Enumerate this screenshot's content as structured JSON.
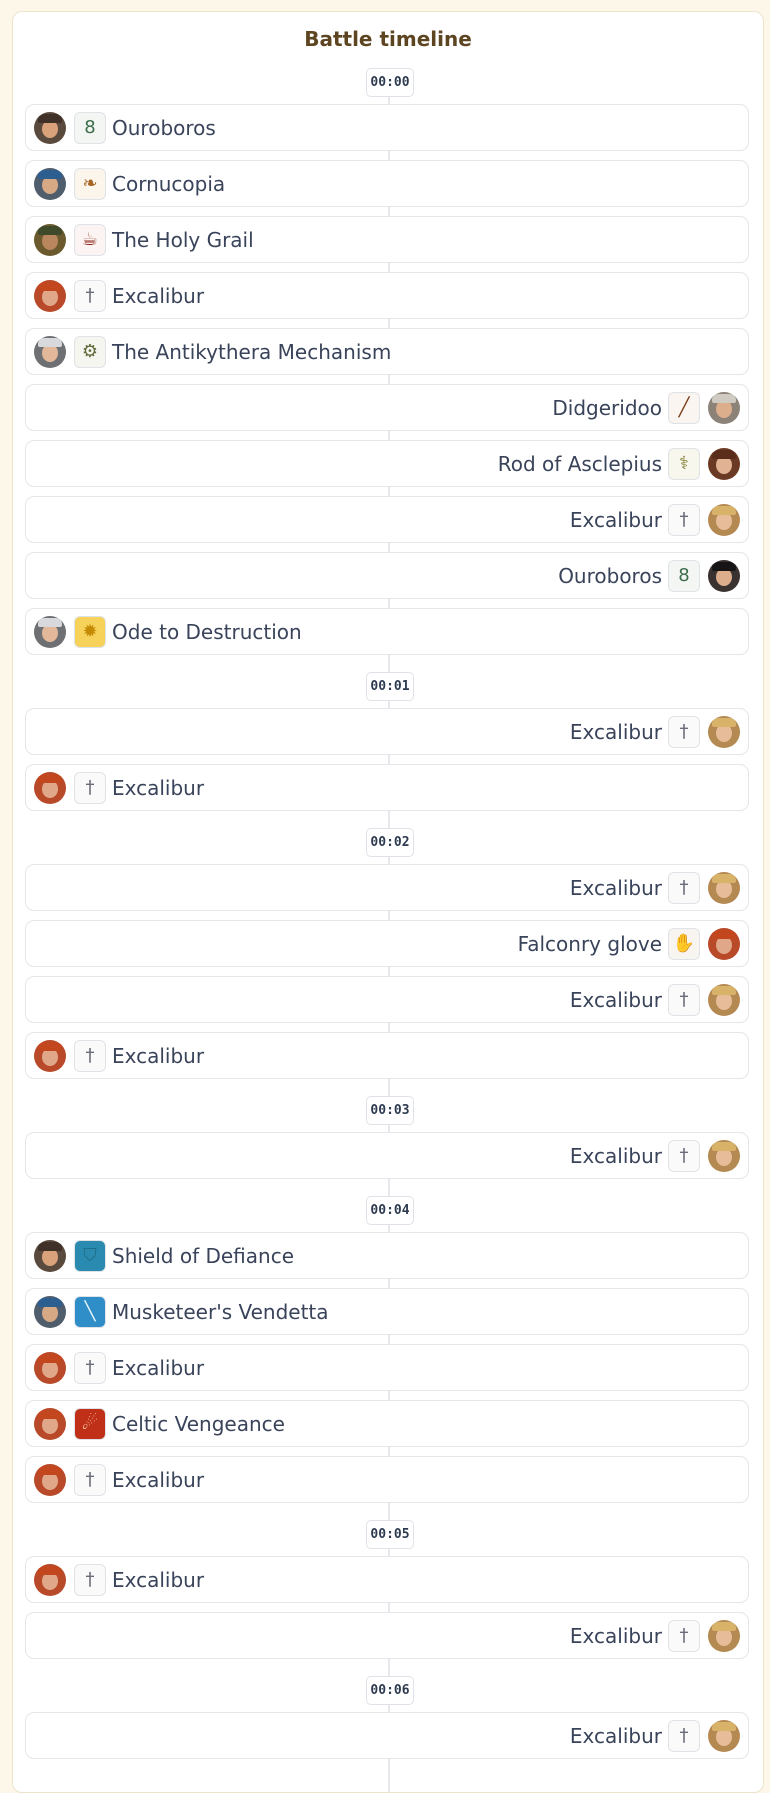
{
  "timeline": {
    "title": "Battle timeline",
    "groups": [
      {
        "time": "00:00",
        "events": [
          {
            "label": "Ouroboros",
            "side": "left",
            "hero": "bearded-warrior",
            "icon": "ouroboros-icon",
            "glyph": "8",
            "glyph_color": "#3d6d4c",
            "tile_bg": "#f3f6f3"
          },
          {
            "label": "Cornucopia",
            "side": "left",
            "hero": "musketeer",
            "icon": "cornucopia-icon",
            "glyph": "❧",
            "glyph_color": "#a86524",
            "tile_bg": "#fbf5ec"
          },
          {
            "label": "The Holy Grail",
            "side": "left",
            "hero": "pharaoh",
            "icon": "holy-grail-icon",
            "glyph": "☕",
            "glyph_color": "#8f2a1d",
            "tile_bg": "#fbf4f2"
          },
          {
            "label": "Excalibur",
            "side": "left",
            "hero": "red-haired-warrior",
            "icon": "excalibur-icon",
            "glyph": "†",
            "glyph_color": "#6a6c78",
            "tile_bg": "#fafafa"
          },
          {
            "label": "The Antikythera Mechanism",
            "side": "left",
            "hero": "grey-sage",
            "icon": "antikythera-mechanism-icon",
            "glyph": "⚙",
            "glyph_color": "#5f6a3a",
            "tile_bg": "#f5f6ef"
          },
          {
            "label": "Didgeridoo",
            "side": "right",
            "hero": "cowboy",
            "icon": "didgeridoo-icon",
            "glyph": "╱",
            "glyph_color": "#7a3e1e",
            "tile_bg": "#fbf5f1"
          },
          {
            "label": "Rod of Asclepius",
            "side": "right",
            "hero": "curly-haired-woman",
            "icon": "rod-of-asclepius-icon",
            "glyph": "⚕",
            "glyph_color": "#7b7a2c",
            "tile_bg": "#f7f7ee"
          },
          {
            "label": "Excalibur",
            "side": "right",
            "hero": "blonde-warrior",
            "icon": "excalibur-icon",
            "glyph": "†",
            "glyph_color": "#6a6c78",
            "tile_bg": "#fafafa"
          },
          {
            "label": "Ouroboros",
            "side": "right",
            "hero": "top-hat-gentleman",
            "icon": "ouroboros-icon",
            "glyph": "8",
            "glyph_color": "#3d6d4c",
            "tile_bg": "#f3f6f3"
          },
          {
            "label": "Ode to Destruction",
            "side": "left",
            "hero": "grey-sage",
            "icon": "ode-to-destruction-icon",
            "glyph": "✹",
            "glyph_color": "#c58a04",
            "tile_bg": "#f6d25a"
          }
        ]
      },
      {
        "time": "00:01",
        "events": [
          {
            "label": "Excalibur",
            "side": "right",
            "hero": "blonde-warrior",
            "icon": "excalibur-icon",
            "glyph": "†",
            "glyph_color": "#6a6c78",
            "tile_bg": "#fafafa"
          },
          {
            "label": "Excalibur",
            "side": "left",
            "hero": "red-haired-warrior",
            "icon": "excalibur-icon",
            "glyph": "†",
            "glyph_color": "#6a6c78",
            "tile_bg": "#fafafa"
          }
        ]
      },
      {
        "time": "00:02",
        "events": [
          {
            "label": "Excalibur",
            "side": "right",
            "hero": "blonde-warrior",
            "icon": "excalibur-icon",
            "glyph": "†",
            "glyph_color": "#6a6c78",
            "tile_bg": "#fafafa"
          },
          {
            "label": "Falconry glove",
            "side": "right",
            "hero": "red-haired-warrior",
            "icon": "falconry-glove-icon",
            "glyph": "✋",
            "glyph_color": "#6b4a33",
            "tile_bg": "#f8f4f0"
          },
          {
            "label": "Excalibur",
            "side": "right",
            "hero": "blonde-warrior",
            "icon": "excalibur-icon",
            "glyph": "†",
            "glyph_color": "#6a6c78",
            "tile_bg": "#fafafa"
          },
          {
            "label": "Excalibur",
            "side": "left",
            "hero": "red-haired-warrior",
            "icon": "excalibur-icon",
            "glyph": "†",
            "glyph_color": "#6a6c78",
            "tile_bg": "#fafafa"
          }
        ]
      },
      {
        "time": "00:03",
        "events": [
          {
            "label": "Excalibur",
            "side": "right",
            "hero": "blonde-warrior",
            "icon": "excalibur-icon",
            "glyph": "†",
            "glyph_color": "#6a6c78",
            "tile_bg": "#fafafa"
          }
        ]
      },
      {
        "time": "00:04",
        "events": [
          {
            "label": "Shield of Defiance",
            "side": "left",
            "hero": "bearded-warrior",
            "icon": "shield-of-defiance-icon",
            "glyph": "⛉",
            "glyph_color": "#1e6f8a",
            "tile_bg": "#2b8ab0"
          },
          {
            "label": "Musketeer's Vendetta",
            "side": "left",
            "hero": "musketeer",
            "icon": "musketeers-vendetta-icon",
            "glyph": "╲",
            "glyph_color": "#e7f6ff",
            "tile_bg": "#2f8dc8"
          },
          {
            "label": "Excalibur",
            "side": "left",
            "hero": "red-haired-warrior",
            "icon": "excalibur-icon",
            "glyph": "†",
            "glyph_color": "#6a6c78",
            "tile_bg": "#fafafa"
          },
          {
            "label": "Celtic Vengeance",
            "side": "left",
            "hero": "red-haired-warrior",
            "icon": "celtic-vengeance-icon",
            "glyph": "☄",
            "glyph_color": "#ffd7b0",
            "tile_bg": "#c02f18"
          },
          {
            "label": "Excalibur",
            "side": "left",
            "hero": "red-haired-warrior",
            "icon": "excalibur-icon",
            "glyph": "†",
            "glyph_color": "#6a6c78",
            "tile_bg": "#fafafa"
          }
        ]
      },
      {
        "time": "00:05",
        "events": [
          {
            "label": "Excalibur",
            "side": "left",
            "hero": "red-haired-warrior",
            "icon": "excalibur-icon",
            "glyph": "†",
            "glyph_color": "#6a6c78",
            "tile_bg": "#fafafa"
          },
          {
            "label": "Excalibur",
            "side": "right",
            "hero": "blonde-warrior",
            "icon": "excalibur-icon",
            "glyph": "†",
            "glyph_color": "#6a6c78",
            "tile_bg": "#fafafa"
          }
        ]
      },
      {
        "time": "00:06",
        "events": [
          {
            "label": "Excalibur",
            "side": "right",
            "hero": "blonde-warrior",
            "icon": "excalibur-icon",
            "glyph": "†",
            "glyph_color": "#6a6c78",
            "tile_bg": "#fafafa"
          }
        ]
      }
    ]
  },
  "heroes": {
    "bearded-warrior": {
      "bg": "#5a4a3e",
      "skin": "#d9a27a",
      "hat": "#3f3128"
    },
    "musketeer": {
      "bg": "#4f5d6c",
      "skin": "#d8a985",
      "hat": "#2c5f8f"
    },
    "pharaoh": {
      "bg": "#6b5a2e",
      "skin": "#b9865e",
      "hat": "#3f4a2a"
    },
    "red-haired-warrior": {
      "bg": "#b84a2a",
      "skin": "#e0a889",
      "hat": "#c2471f"
    },
    "grey-sage": {
      "bg": "#6f7073",
      "skin": "#e3b79a",
      "hat": "#d8d9dc"
    },
    "cowboy": {
      "bg": "#8c8278",
      "skin": "#dcae8c",
      "hat": "#cfcac2"
    },
    "curly-haired-woman": {
      "bg": "#6b3a24",
      "skin": "#e2b294",
      "hat": "#5a2d1a"
    },
    "blonde-warrior": {
      "bg": "#b48a52",
      "skin": "#e6bd98",
      "hat": "#d9b26a"
    },
    "top-hat-gentleman": {
      "bg": "#3a3230",
      "skin": "#dcae8c",
      "hat": "#161414"
    }
  },
  "colors": {
    "page_bg": "#fcf7e9",
    "title": "#5d4521",
    "text": "#39435a",
    "border": "#e4e6ea"
  }
}
